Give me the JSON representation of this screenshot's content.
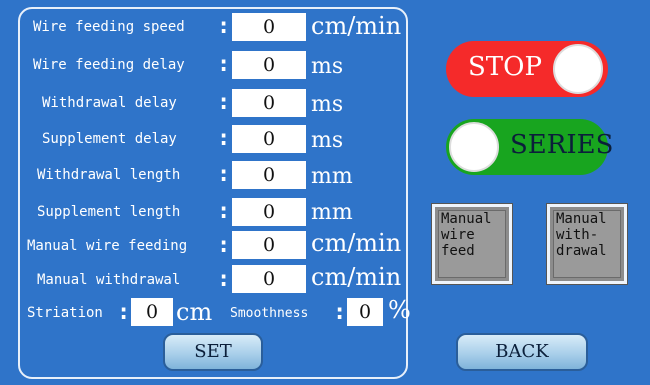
{
  "params": [
    {
      "label": "Wire feeding speed",
      "value": "0",
      "unit": "cm/min"
    },
    {
      "label": "Wire feeding delay",
      "value": "0",
      "unit": "ms"
    },
    {
      "label": "Withdrawal delay",
      "value": "0",
      "unit": "ms"
    },
    {
      "label": "Supplement delay",
      "value": "0",
      "unit": "ms"
    },
    {
      "label": "Withdrawal length",
      "value": "0",
      "unit": "mm"
    },
    {
      "label": "Supplement length",
      "value": "0",
      "unit": "mm"
    },
    {
      "label": "Manual wire feeding",
      "value": "0",
      "unit": "cm/min"
    },
    {
      "label": "Manual withdrawal",
      "value": "0",
      "unit": "cm/min"
    }
  ],
  "colon": ":",
  "striation": {
    "label": "Striation",
    "value": "0",
    "unit": "cm"
  },
  "smoothness": {
    "label": "Smoothness",
    "value": "0",
    "unit": "%"
  },
  "buttons": {
    "set": "SET",
    "back": "BACK"
  },
  "toggles": {
    "stop": {
      "label": "STOP",
      "color": "#f52a2a"
    },
    "series": {
      "label": "SERIES",
      "color": "#18a51f"
    }
  },
  "manual": {
    "feed": "Manual\nwire\nfeed",
    "withdrawal": "Manual\nwith-\ndrawal"
  },
  "colors": {
    "background": "#2f74c9",
    "text": "#ffffff"
  }
}
